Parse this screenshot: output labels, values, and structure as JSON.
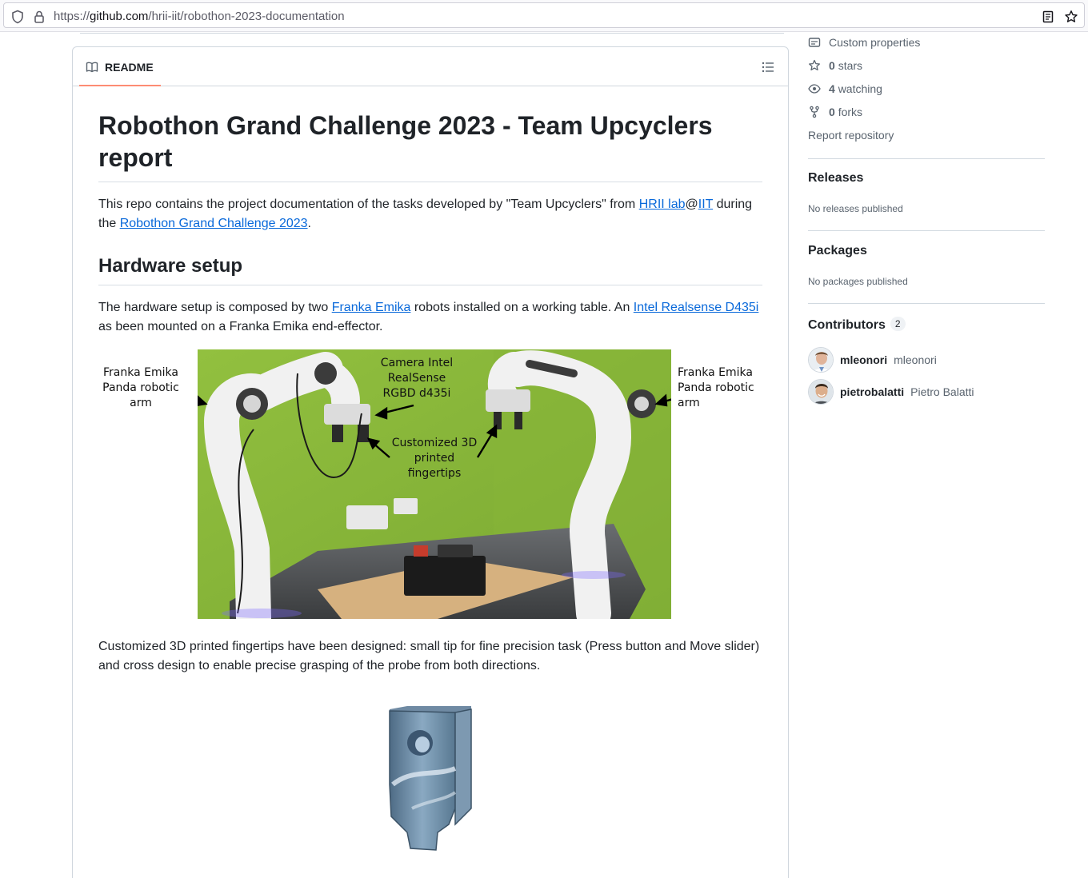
{
  "browser": {
    "url_prefix": "https://",
    "url_host": "github.com",
    "url_path": "/hrii-iit/robothon-2023-documentation"
  },
  "readme": {
    "tab_label": "README",
    "title": "Robothon Grand Challenge 2023 - Team Upcyclers report",
    "intro": {
      "t1": "This repo contains the project documentation of the tasks developed by \"Team Upcyclers\" from ",
      "link1": "HRII lab",
      "t2": "@",
      "link2": "IIT",
      "t3": " during the ",
      "link3": "Robothon Grand Challenge 2023",
      "t4": "."
    },
    "hardware_heading": "Hardware setup",
    "hardware": {
      "t1": "The hardware setup is composed by two ",
      "link1": "Franka Emika",
      "t2": " robots installed on a working table. An ",
      "link2": "Intel Realsense D435i",
      "t3": " as been mounted on a Franka Emika end-effector."
    },
    "figure_labels": {
      "left_arm": "Franka Emika\nPanda robotic\narm",
      "right_arm": "Franka Emika\nPanda robotic\narm",
      "camera": "Camera Intel\nRealSense\nRGBD d435i",
      "fingertips": "Customized 3D\nprinted\nfingertips"
    },
    "fingertips_paragraph": "Customized 3D printed fingertips have been designed: small tip for fine precision task (Press button and Move slider) and cross design to enable precise grasping of the probe from both directions."
  },
  "sidebar": {
    "custom_properties": "Custom properties",
    "stars_count": "0",
    "stars_label": "stars",
    "watching_count": "4",
    "watching_label": "watching",
    "forks_count": "0",
    "forks_label": "forks",
    "report": "Report repository",
    "releases_heading": "Releases",
    "releases_empty": "No releases published",
    "packages_heading": "Packages",
    "packages_empty": "No packages published",
    "contributors_heading": "Contributors",
    "contributors_count": "2",
    "contributors": [
      {
        "login": "mleonori",
        "name": "mleonori"
      },
      {
        "login": "pietrobalatti",
        "name": "Pietro Balatti"
      }
    ]
  },
  "colors": {
    "link": "#0969da",
    "tab_underline": "#fd8c73",
    "green_wall": "#8cb83a"
  },
  "icons": [
    "shield-icon",
    "lock-icon",
    "reader-mode-icon",
    "bookmark-star-icon",
    "book-icon",
    "list-outline-icon",
    "note-icon",
    "star-icon",
    "eye-icon",
    "fork-icon"
  ]
}
